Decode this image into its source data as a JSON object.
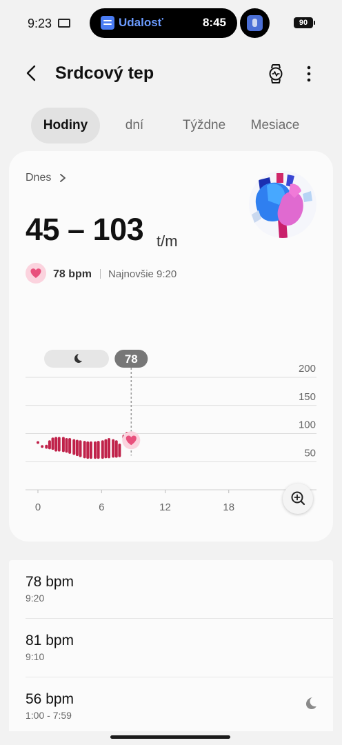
{
  "status_bar": {
    "time": "9:23",
    "island_label": "Udalosť",
    "island_time": "8:45",
    "battery": "90"
  },
  "header": {
    "title": "Srdcový tep"
  },
  "tabs": [
    {
      "label": "Hodiny",
      "active": true
    },
    {
      "label": "dní",
      "active": false
    },
    {
      "label": "Týždne",
      "active": false
    },
    {
      "label": "Mesiace",
      "active": false
    }
  ],
  "summary": {
    "period": "Dnes",
    "range": "45 – 103",
    "unit": "t/m",
    "latest_bpm": "78 bpm",
    "latest_time": "Najnovšie 9:20"
  },
  "chart_data": {
    "type": "bar",
    "description_kind": "range",
    "x_ticks": [
      "0",
      "6",
      "12",
      "18"
    ],
    "xlim": [
      0,
      24
    ],
    "y_ticks": [
      "200",
      "150",
      "100",
      "50"
    ],
    "ylim": [
      0,
      200
    ],
    "selected_value": "78",
    "selected_x": 8.8,
    "sleep_span": [
      4.3,
      8.7
    ],
    "bar_color": "#c0224a",
    "ranges": [
      {
        "x": 0.0,
        "low": 84,
        "high": 84
      },
      {
        "x": 0.4,
        "low": 77,
        "high": 78
      },
      {
        "x": 0.8,
        "low": 73,
        "high": 80
      },
      {
        "x": 1.1,
        "low": 72,
        "high": 88
      },
      {
        "x": 1.4,
        "low": 71,
        "high": 93
      },
      {
        "x": 1.7,
        "low": 68,
        "high": 94
      },
      {
        "x": 2.0,
        "low": 68,
        "high": 94
      },
      {
        "x": 2.4,
        "low": 67,
        "high": 94
      },
      {
        "x": 2.7,
        "low": 66,
        "high": 92
      },
      {
        "x": 3.0,
        "low": 64,
        "high": 92
      },
      {
        "x": 3.4,
        "low": 62,
        "high": 90
      },
      {
        "x": 3.7,
        "low": 60,
        "high": 89
      },
      {
        "x": 4.0,
        "low": 58,
        "high": 88
      },
      {
        "x": 4.4,
        "low": 56,
        "high": 87
      },
      {
        "x": 4.7,
        "low": 55,
        "high": 86
      },
      {
        "x": 5.0,
        "low": 55,
        "high": 86
      },
      {
        "x": 5.4,
        "low": 55,
        "high": 86
      },
      {
        "x": 5.7,
        "low": 55,
        "high": 87
      },
      {
        "x": 6.1,
        "low": 55,
        "high": 88
      },
      {
        "x": 6.4,
        "low": 56,
        "high": 90
      },
      {
        "x": 6.7,
        "low": 56,
        "high": 92
      },
      {
        "x": 7.1,
        "low": 57,
        "high": 90
      },
      {
        "x": 7.4,
        "low": 57,
        "high": 88
      },
      {
        "x": 7.7,
        "low": 58,
        "high": 82
      },
      {
        "x": 8.1,
        "low": 90,
        "high": 98
      },
      {
        "x": 8.4,
        "low": 96,
        "high": 103
      }
    ]
  },
  "list": [
    {
      "bpm": "78 bpm",
      "time": "9:20",
      "sleep": false
    },
    {
      "bpm": "81 bpm",
      "time": "9:10",
      "sleep": false
    },
    {
      "bpm": "56 bpm",
      "time": "1:00 - 7:59",
      "sleep": true
    }
  ],
  "icons": {
    "back": "chevron-left-icon",
    "watch": "watch-icon",
    "more": "more-vertical-icon",
    "heart": "heart-icon",
    "moon": "moon-icon",
    "zoom": "zoom-in-icon"
  },
  "colors": {
    "accent_heart": "#e8507c",
    "bar": "#c0224a",
    "card_bg": "#fbfbfb",
    "page_bg": "#f2f2f2"
  }
}
